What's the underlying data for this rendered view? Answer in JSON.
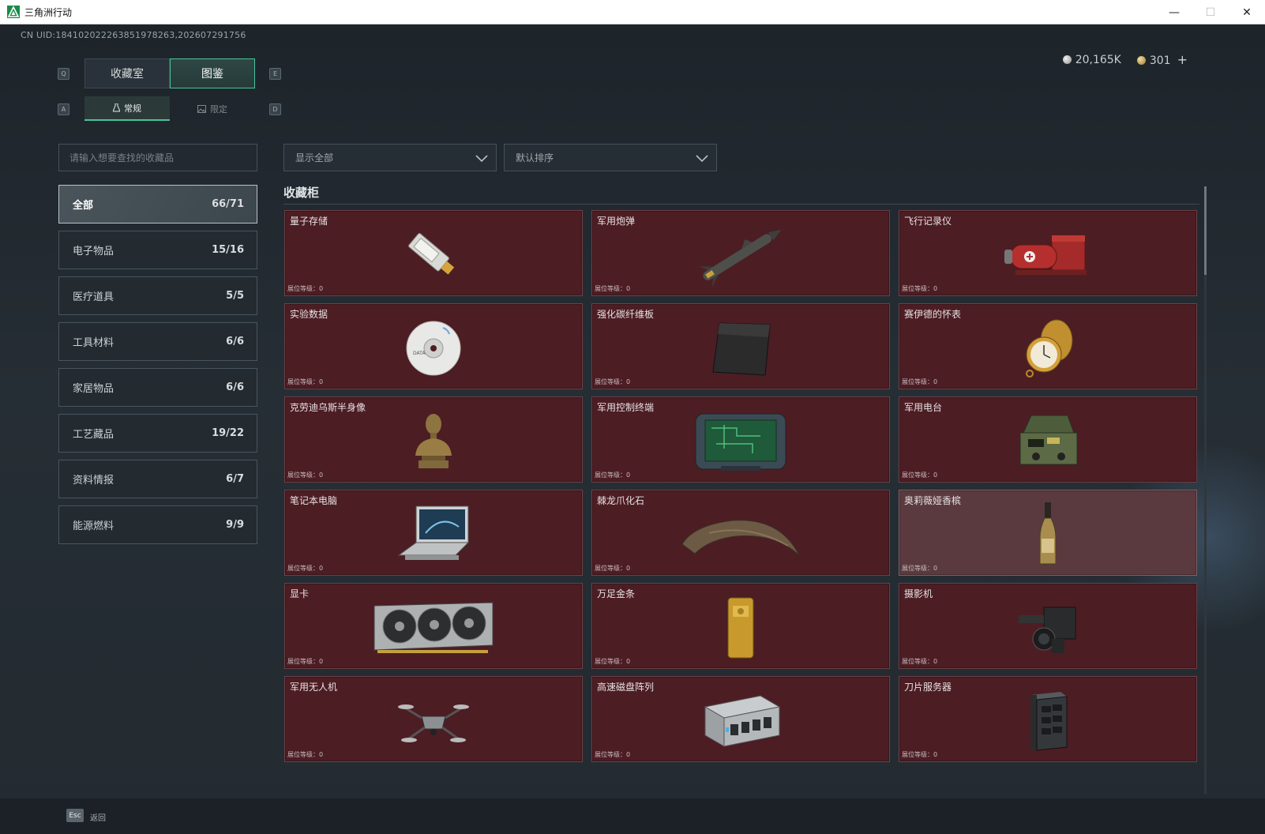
{
  "window": {
    "title": "三角洲行动",
    "minimize": "—",
    "maximize": "☐",
    "close": "✕"
  },
  "uid_text": "CN UID:184102022263851978263,202607291756",
  "currency": {
    "silver": "20,165K",
    "gold": "301",
    "plus": "+"
  },
  "keys": {
    "q": "Q",
    "e": "E",
    "a": "A",
    "d": "D"
  },
  "tabs": {
    "main": [
      "收藏室",
      "图鉴"
    ],
    "active_main": 1,
    "sub": [
      "常规",
      "限定"
    ],
    "active_sub": 0
  },
  "search": {
    "placeholder": "请输入想要查找的收藏品",
    "value": ""
  },
  "filters": {
    "display": "显示全部",
    "sort": "默认排序"
  },
  "categories": [
    {
      "label": "全部",
      "count": "66/71",
      "active": true
    },
    {
      "label": "电子物品",
      "count": "15/16"
    },
    {
      "label": "医疗道具",
      "count": "5/5"
    },
    {
      "label": "工具材料",
      "count": "6/6"
    },
    {
      "label": "家居物品",
      "count": "6/6"
    },
    {
      "label": "工艺藏品",
      "count": "19/22"
    },
    {
      "label": "资料情报",
      "count": "6/7"
    },
    {
      "label": "能源燃料",
      "count": "9/9"
    }
  ],
  "section_title": "收藏柜",
  "items": [
    {
      "name": "量子存储",
      "level": "展位等级：0",
      "icon": "usb-drive-icon"
    },
    {
      "name": "军用炮弹",
      "level": "展位等级：0",
      "icon": "missile-icon"
    },
    {
      "name": "飞行记录仪",
      "level": "展位等级：0",
      "icon": "flight-recorder-icon"
    },
    {
      "name": "实验数据",
      "level": "展位等级：0",
      "icon": "disc-icon"
    },
    {
      "name": "强化碳纤维板",
      "level": "展位等级：0",
      "icon": "carbon-plate-icon"
    },
    {
      "name": "赛伊德的怀表",
      "level": "展位等级：0",
      "icon": "pocket-watch-icon"
    },
    {
      "name": "克劳迪乌斯半身像",
      "level": "展位等级：0",
      "icon": "bust-icon"
    },
    {
      "name": "军用控制终端",
      "level": "展位等级：0",
      "icon": "control-terminal-icon"
    },
    {
      "name": "军用电台",
      "level": "展位等级：0",
      "icon": "radio-icon"
    },
    {
      "name": "笔记本电脑",
      "level": "展位等级：0",
      "icon": "laptop-icon"
    },
    {
      "name": "棘龙爪化石",
      "level": "展位等级：0",
      "icon": "claw-fossil-icon"
    },
    {
      "name": "奥莉薇娅香槟",
      "level": "展位等级：0",
      "icon": "champagne-icon",
      "highlight": true
    },
    {
      "name": "显卡",
      "level": "展位等级：0",
      "icon": "gpu-icon"
    },
    {
      "name": "万足金条",
      "level": "展位等级：0",
      "icon": "gold-bar-icon"
    },
    {
      "name": "摄影机",
      "level": "展位等级：0",
      "icon": "camera-icon"
    },
    {
      "name": "军用无人机",
      "level": "展位等级：0",
      "icon": "drone-icon"
    },
    {
      "name": "高速磁盘阵列",
      "level": "展位等级：0",
      "icon": "disk-array-icon"
    },
    {
      "name": "刀片服务器",
      "level": "展位等级：0",
      "icon": "blade-server-icon"
    }
  ],
  "footer": {
    "esc_key": "Esc",
    "back": "返回"
  },
  "colors": {
    "accent": "#49c49a",
    "card_bg": "#4d1d24",
    "card_highlight": "#5a3a3f"
  }
}
